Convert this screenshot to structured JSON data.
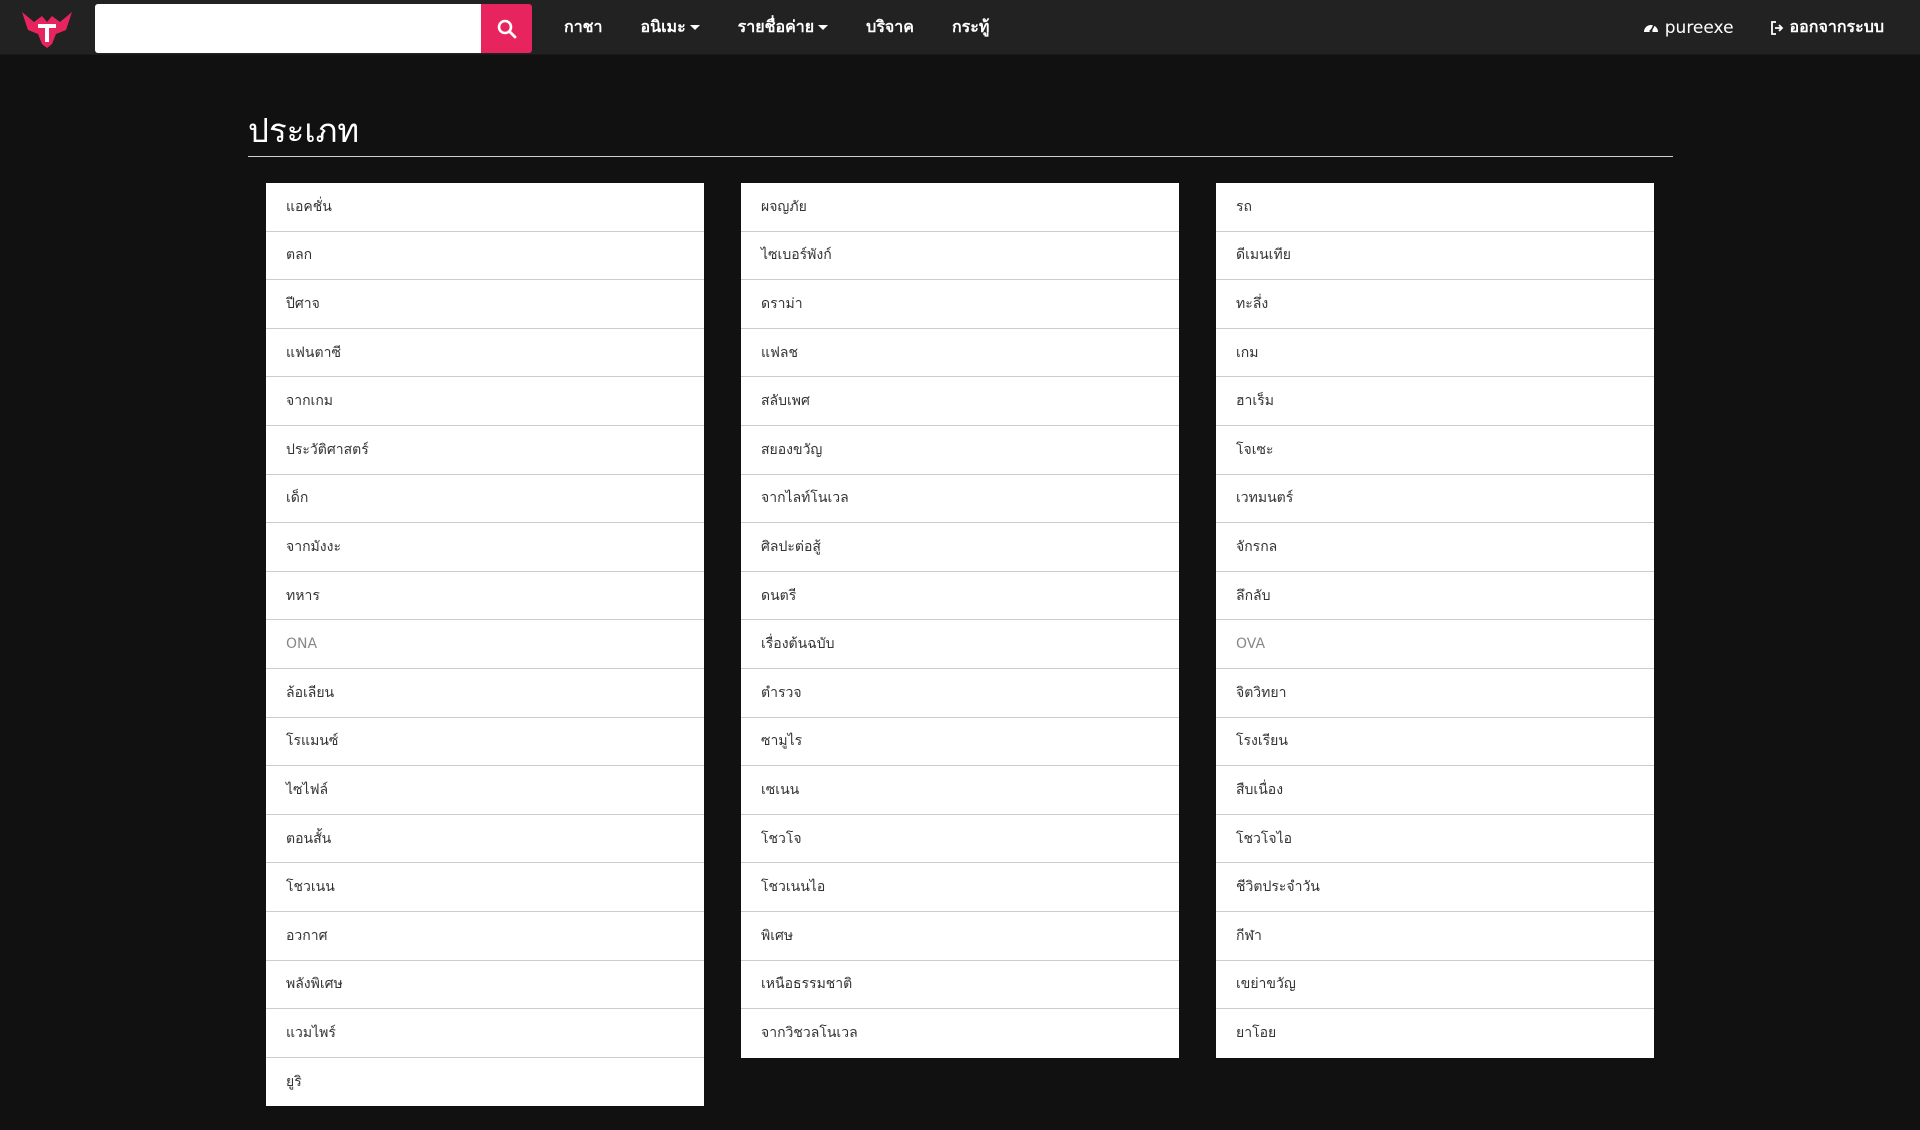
{
  "navbar": {
    "search_placeholder": "",
    "links": [
      {
        "label": "กาชา",
        "dropdown": false
      },
      {
        "label": "อนิเมะ",
        "dropdown": true
      },
      {
        "label": "รายชื่อค่าย",
        "dropdown": true
      },
      {
        "label": "บริจาค",
        "dropdown": false
      },
      {
        "label": "กระทู้",
        "dropdown": false
      }
    ],
    "user": "pureexe",
    "logout": "ออกจากระบบ",
    "accent_color": "#e8245f"
  },
  "main": {
    "title": "ประเภท",
    "columns": [
      [
        "แอคชั่น",
        "ตลก",
        "ปีศาจ",
        "แฟนตาซี",
        "จากเกม",
        "ประวัติศาสตร์",
        "เด็ก",
        "จากมังงะ",
        "ทหาร",
        "ONA",
        "ล้อเลียน",
        "โรแมนซ์",
        "ไซไฟล์",
        "ตอนสั้น",
        "โชวเนน",
        "อวกาศ",
        "พลังพิเศษ",
        "แวมไพร์",
        "ยูริ"
      ],
      [
        "ผจญภัย",
        "ไซเบอร์พังก์",
        "ดราม่า",
        "แฟลช",
        "สลับเพศ",
        "สยองขวัญ",
        "จากไลท์โนเวล",
        "ศิลปะต่อสู้",
        "ดนตรี",
        "เรื่องต้นฉบับ",
        "ตำรวจ",
        "ซามูไร",
        "เซเนน",
        "โชวโจ",
        "โชวเนนไอ",
        "พิเศษ",
        "เหนือธรรมชาติ",
        "จากวิชวลโนเวล"
      ],
      [
        "รถ",
        "ดีเมนเทีย",
        "ทะลึ่ง",
        "เกม",
        "ฮาเร็ม",
        "โจเซะ",
        "เวทมนตร์",
        "จักรกล",
        "ลึกลับ",
        "OVA",
        "จิตวิทยา",
        "โรงเรียน",
        "สืบเนื่อง",
        "โชวโจไอ",
        "ชีวิตประจำวัน",
        "กีฬา",
        "เขย่าขวัญ",
        "ยาโอย"
      ]
    ]
  }
}
